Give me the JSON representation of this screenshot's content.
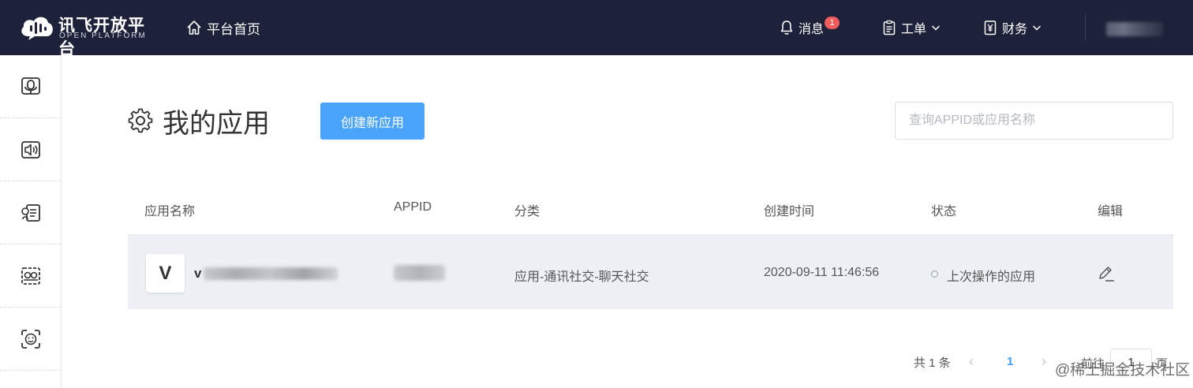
{
  "brand": {
    "title": "讯飞开放平台",
    "subtitle": "OPEN PLATFORM"
  },
  "topnav": {
    "home_label": "平台首页",
    "messages_label": "消息",
    "messages_badge": "1",
    "tickets_label": "工单",
    "finance_label": "财务"
  },
  "sidebar": {
    "icons": [
      "voice-dictation-icon",
      "speech-synthesis-icon",
      "text-recognition-icon",
      "translation-icon",
      "face-recognition-icon"
    ]
  },
  "main": {
    "title": "我的应用",
    "create_button": "创建新应用",
    "search_placeholder": "查询APPID或应用名称"
  },
  "table": {
    "headers": [
      "应用名称",
      "APPID",
      "分类",
      "创建时间",
      "状态",
      "编辑"
    ],
    "rows": [
      {
        "icon_letter": "V",
        "name": "v",
        "category": "应用-通讯社交-聊天社交",
        "created": "2020-09-11 11:46:56",
        "status": "上次操作的应用"
      }
    ]
  },
  "pagination": {
    "total": "共 1 条",
    "current_page": "1",
    "goto_label": "前往",
    "goto_value": "1",
    "page_suffix": "页"
  },
  "watermark": {
    "text": "@稀土掘金技术社区"
  },
  "colors": {
    "topbar": "#1d2139",
    "primary": "#4aa4fb",
    "row_bg": "#edf1f6",
    "badge": "#f05b5b"
  }
}
